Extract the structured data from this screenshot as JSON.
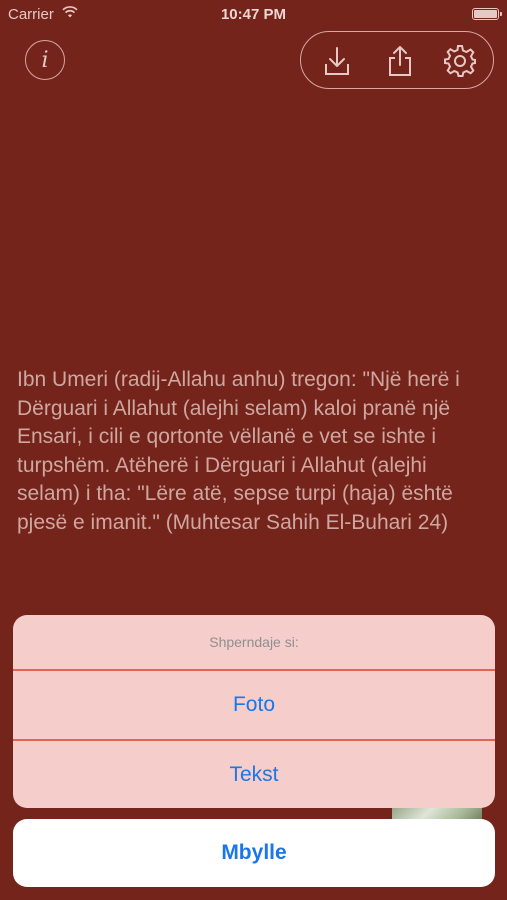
{
  "status_bar": {
    "carrier": "Carrier",
    "time": "10:47 PM",
    "wifi_icon": "wifi-icon",
    "battery_icon": "battery-icon"
  },
  "top_controls": {
    "info_icon": "info-icon",
    "info_glyph": "i",
    "toolbar_icons": [
      "download-icon",
      "share-icon",
      "gear-icon"
    ]
  },
  "content": {
    "hadith_text": "Ibn Umeri (radij-Allahu anhu) tregon: \"Një herë i Dërguari i Allahut (alejhi selam) kaloi pranë një Ensari, i cili e qortonte vëllanë e vet se ishte i turpshëm. Atëherë i Dërguari i Allahut (alejhi selam) i tha: \"Lëre atë, sepse turpi (haja) është pjesë e imanit.\" (Muhtesar Sahih El-Buhari 24)"
  },
  "action_sheet": {
    "title": "Shperndaje si:",
    "actions": [
      {
        "label": "Foto"
      },
      {
        "label": "Tekst"
      }
    ],
    "cancel_label": "Mbylle"
  },
  "colors": {
    "background": "#74241b",
    "body_text": "#cfa7a1",
    "sheet_background": "#f5cdcb",
    "sheet_divider": "#e2655a",
    "action_text": "#1b76ea"
  }
}
